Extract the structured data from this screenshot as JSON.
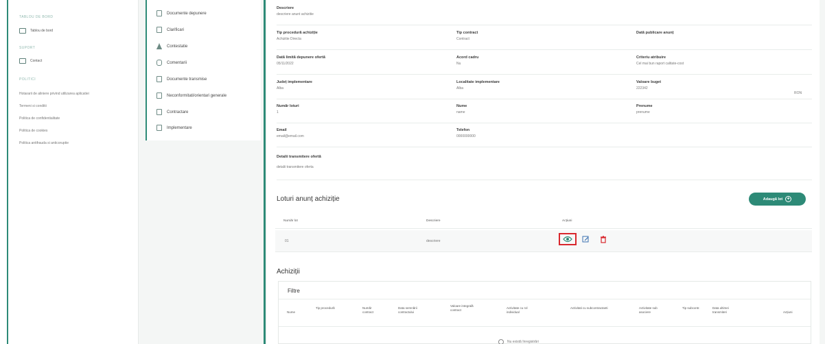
{
  "sidebar": {
    "sections": [
      "TABLOU DE BORD",
      "SUPORT",
      "POLITICI"
    ],
    "items": [
      {
        "label": "Tablou de bord",
        "icon": "dashboard-icon"
      },
      {
        "label": "Contact",
        "icon": "mail-icon"
      }
    ],
    "links": [
      "Hotararii de aliniere privind utilizarea aplicatiei",
      "Termeni si conditii",
      "Politica de confidentialitate",
      "Politica de cookies",
      "Politica antifrauda si anticoruptie"
    ]
  },
  "submenu": {
    "items": [
      {
        "label": "Documente depunere",
        "icon": "document-icon"
      },
      {
        "label": "Clarificari",
        "icon": "clipboard-icon"
      },
      {
        "label": "Contestatie",
        "icon": "warning-icon"
      },
      {
        "label": "Comentarii",
        "icon": "comment-icon"
      },
      {
        "label": "Documente transmise",
        "icon": "document-icon"
      },
      {
        "label": "Neconformitati/orientari generale",
        "icon": "document-icon"
      },
      {
        "label": "Contractare",
        "icon": "contract-icon"
      },
      {
        "label": "Implementare",
        "icon": "calendar-icon"
      }
    ]
  },
  "details": {
    "descriere": {
      "label": "Descriere",
      "value": "descriere anunt achizitie"
    },
    "tip_procedura": {
      "label": "Tip procedură achiziție",
      "value": "Achizitie Directa"
    },
    "tip_contract": {
      "label": "Tip contract",
      "value": "Contract"
    },
    "data_publicare": {
      "label": "Dată publicare anunț",
      "value": ""
    },
    "data_limita": {
      "label": "Dată limită depunere ofertă",
      "value": "05/11/2022"
    },
    "acord_cadru": {
      "label": "Acord cadru",
      "value": "Nu"
    },
    "criteriu": {
      "label": "Criteriu atribuire",
      "value": "Cel mai bun raport calitate-cost"
    },
    "judet": {
      "label": "Județ implementare",
      "value": "Alba"
    },
    "localitate": {
      "label": "Localitate implementare",
      "value": "Alba"
    },
    "valoare_buget": {
      "label": "Valoare buget",
      "value": "222342",
      "currency": "RON"
    },
    "numar_loturi": {
      "label": "Număr loturi",
      "value": "1"
    },
    "nume": {
      "label": "Nume",
      "value": "name"
    },
    "prenume": {
      "label": "Prenume",
      "value": "prenume"
    },
    "email": {
      "label": "Email",
      "value": "email@email.com"
    },
    "telefon": {
      "label": "Telefon",
      "value": "0000000000"
    },
    "detalii_transmitere": {
      "label": "Detalii transmitere ofertă",
      "value": "detalii transmitere oferta"
    }
  },
  "loturi": {
    "title": "Loturi anunț achiziție",
    "add_button": "Adaugă lot",
    "columns": [
      "Număr lot",
      "Descriere",
      "Acțiuni"
    ],
    "rows": [
      {
        "numar": "01",
        "descriere": "descriere"
      }
    ]
  },
  "achizitii": {
    "title": "Achiziții",
    "filters_title": "Filtre",
    "columns": [
      "Nume",
      "Tip procedură",
      "Număr contract",
      "Data semnării contractului",
      "Valoare integrală contract",
      "Activitate cu rol individual",
      "Activitati cu subcontractanti",
      "Activitate sub asociere",
      "Tip subcontr.",
      "Data ultimei transmiteri",
      "Acțiuni"
    ],
    "empty_text": "Nu există înregistrări"
  },
  "colors": {
    "accent": "#2d8a77",
    "highlight": "#d8262c",
    "delete": "#d8262c",
    "edit": "#3a6fb0"
  }
}
